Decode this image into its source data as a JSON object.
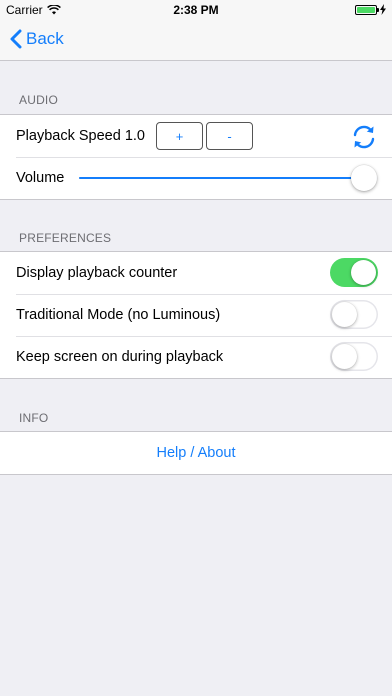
{
  "status": {
    "carrier": "Carrier",
    "time": "2:38 PM",
    "battery_level": 1.0
  },
  "nav": {
    "back_label": "Back"
  },
  "audio": {
    "header": "AUDIO",
    "playback_speed_label": "Playback Speed 1.0",
    "increase_label": "+",
    "decrease_label": "-",
    "volume_label": "Volume",
    "volume_level": 1.0
  },
  "preferences": {
    "header": "PREFERENCES",
    "items": [
      {
        "label": "Display playback counter",
        "on": true
      },
      {
        "label": "Traditional Mode (no Luminous)",
        "on": false
      },
      {
        "label": "Keep screen on during playback",
        "on": false
      }
    ]
  },
  "info": {
    "header": "INFO",
    "help_label": "Help / About"
  },
  "colors": {
    "accent": "#147efb",
    "toggle_on": "#4cd964",
    "background": "#efeff4"
  }
}
